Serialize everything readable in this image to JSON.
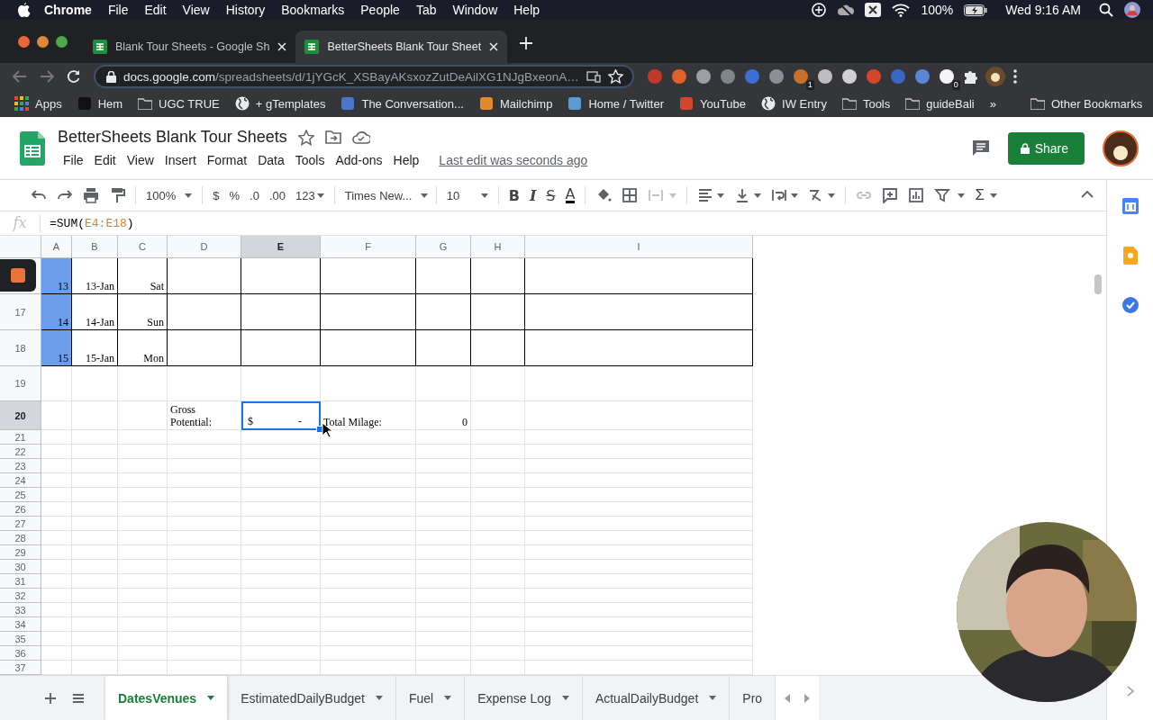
{
  "menu_bar": {
    "app": "Chrome",
    "items": [
      "File",
      "Edit",
      "View",
      "History",
      "Bookmarks",
      "People",
      "Tab",
      "Window",
      "Help"
    ],
    "battery": "100%",
    "clock": "Wed 9:16 AM"
  },
  "browser": {
    "tabs": [
      {
        "title": "Blank Tour Sheets - Google Sh",
        "selected": false
      },
      {
        "title": "BetterSheets Blank Tour Sheet",
        "selected": true
      }
    ],
    "address": {
      "host": "docs.google.com",
      "path": "/spreadsheets/d/1jYGcK_XSBayAKsxozZutDeAilXG1NJgBxeonA…"
    },
    "extensions": [
      {
        "color": "#c0392b"
      },
      {
        "color": "#e0622a"
      },
      {
        "color": "#9aa0a6"
      },
      {
        "color": "#80868b"
      },
      {
        "color": "#3b6fd4"
      },
      {
        "color": "#8a8f96"
      },
      {
        "color": "#c9702b",
        "badge": "1"
      },
      {
        "color": "#bdbdbd"
      },
      {
        "color": "#d0d0d0"
      },
      {
        "color": "#d6452a"
      },
      {
        "color": "#3a67c4"
      },
      {
        "color": "#5a86d6"
      },
      {
        "color": "#f5f5f5",
        "badge": "0"
      }
    ],
    "bookmarks": [
      {
        "label": "Apps",
        "kind": "grid"
      },
      {
        "label": "Hem",
        "kind": "favicon",
        "color": "#111111"
      },
      {
        "label": "UGC TRUE",
        "kind": "folder"
      },
      {
        "label": "+ gTemplates",
        "kind": "globe"
      },
      {
        "label": "The Conversation...",
        "kind": "favicon",
        "color": "#4a78c8"
      },
      {
        "label": "Mailchimp",
        "kind": "favicon",
        "color": "#e08a2c"
      },
      {
        "label": "Home / Twitter",
        "kind": "favicon",
        "color": "#5b9bd5"
      },
      {
        "label": "YouTube",
        "kind": "favicon",
        "color": "#d6452a"
      },
      {
        "label": "IW Entry",
        "kind": "globe"
      },
      {
        "label": "Tools",
        "kind": "folder"
      },
      {
        "label": "guideBali",
        "kind": "folder"
      }
    ],
    "bookmarks_more": "»",
    "other_bookmarks": "Other Bookmarks"
  },
  "sheets": {
    "title": "BetterSheets Blank Tour Sheets",
    "menu": [
      "File",
      "Edit",
      "View",
      "Insert",
      "Format",
      "Data",
      "Tools",
      "Add-ons",
      "Help"
    ],
    "last_edit": "Last edit was seconds ago",
    "share": "Share"
  },
  "toolbar": {
    "zoom": "100%",
    "currency": "$",
    "percent": "%",
    "decrease_decimals": ".0",
    "increase_decimals": ".00",
    "more_formats": "123",
    "font": "Times New...",
    "font_size": "10",
    "bold": "B",
    "italic": "I",
    "strikethrough": "S",
    "text_color": "A",
    "functions": "Σ"
  },
  "formula_bar": {
    "fx": "fx",
    "prefix": "=SUM(",
    "range": "E4:E18",
    "suffix": ")"
  },
  "grid": {
    "columns": [
      {
        "label": "A",
        "selected": false
      },
      {
        "label": "B",
        "selected": false
      },
      {
        "label": "C",
        "selected": false
      },
      {
        "label": "D",
        "selected": false
      },
      {
        "label": "E",
        "selected": true
      },
      {
        "label": "F",
        "selected": false
      },
      {
        "label": "G",
        "selected": false
      },
      {
        "label": "H",
        "selected": false
      },
      {
        "label": "I",
        "selected": false
      }
    ],
    "rows": [
      {
        "kind": "boxed",
        "selected": false,
        "cells": [
          {
            "text": "13",
            "kind": "number",
            "selected": false
          },
          {
            "text": "13-Jan",
            "kind": "number",
            "selected": false
          },
          {
            "text": "Sat",
            "kind": "number",
            "selected": false
          },
          {
            "selected": false
          },
          {
            "selected": false
          },
          {
            "selected": false
          },
          {
            "selected": false
          },
          {
            "selected": false
          },
          {
            "selected": false
          }
        ]
      },
      {
        "kind": "boxed",
        "number": "17",
        "selected": false,
        "cells": [
          {
            "text": "14",
            "kind": "number",
            "selected": false
          },
          {
            "text": "14-Jan",
            "kind": "number",
            "selected": false
          },
          {
            "text": "Sun",
            "kind": "number",
            "selected": false
          },
          {
            "selected": false
          },
          {
            "selected": false
          },
          {
            "selected": false
          },
          {
            "selected": false
          },
          {
            "selected": false
          },
          {
            "selected": false
          }
        ]
      },
      {
        "kind": "boxed",
        "number": "18",
        "selected": false,
        "cells": [
          {
            "text": "15",
            "kind": "number",
            "selected": false
          },
          {
            "text": "15-Jan",
            "kind": "number",
            "selected": false
          },
          {
            "text": "Mon",
            "kind": "number",
            "selected": false
          },
          {
            "selected": false
          },
          {
            "selected": false
          },
          {
            "selected": false
          },
          {
            "selected": false
          },
          {
            "selected": false
          },
          {
            "selected": false
          }
        ]
      },
      {
        "kind": "spacer",
        "number": "19",
        "selected": false
      },
      {
        "kind": "form",
        "number": "20",
        "selected": true,
        "cells": [
          {
            "selected": false
          },
          {
            "selected": false
          },
          {
            "selected": false
          },
          {
            "text": "Gross Potential:",
            "kind": "text",
            "selected": false
          },
          {
            "text": "$",
            "trail": "-",
            "kind": "currency",
            "selected": true
          },
          {
            "text": "Total Milage:",
            "kind": "text",
            "selected": false
          },
          {
            "text": "0",
            "kind": "number",
            "selected": false
          },
          {
            "selected": false
          },
          {
            "selected": false
          }
        ]
      },
      {
        "kind": "plain",
        "number": "21",
        "selected": false
      },
      {
        "kind": "plain",
        "number": "22",
        "selected": false
      },
      {
        "kind": "plain",
        "number": "23",
        "selected": false
      },
      {
        "kind": "plain",
        "number": "24",
        "selected": false
      },
      {
        "kind": "plain",
        "number": "25",
        "selected": false
      },
      {
        "kind": "plain",
        "number": "26",
        "selected": false
      },
      {
        "kind": "plain",
        "number": "27",
        "selected": false
      },
      {
        "kind": "plain",
        "number": "28",
        "selected": false
      },
      {
        "kind": "plain",
        "number": "29",
        "selected": false
      },
      {
        "kind": "plain",
        "number": "30",
        "selected": false
      },
      {
        "kind": "plain",
        "number": "31",
        "selected": false
      },
      {
        "kind": "plain",
        "number": "32",
        "selected": false
      },
      {
        "kind": "plain",
        "number": "33",
        "selected": false
      },
      {
        "kind": "plain",
        "number": "34",
        "selected": false
      },
      {
        "kind": "plain",
        "number": "35",
        "selected": false
      },
      {
        "kind": "plain",
        "number": "36",
        "selected": false
      },
      {
        "kind": "plain",
        "number": "37",
        "selected": false
      }
    ]
  },
  "sheet_tabs": [
    {
      "label": "DatesVenues",
      "selected": true
    },
    {
      "label": "EstimatedDailyBudget",
      "selected": false
    },
    {
      "label": "Fuel",
      "selected": false
    },
    {
      "label": "Expense Log",
      "selected": false
    },
    {
      "label": "ActualDailyBudget",
      "selected": false
    },
    {
      "label": "Pro",
      "selected": false
    }
  ]
}
